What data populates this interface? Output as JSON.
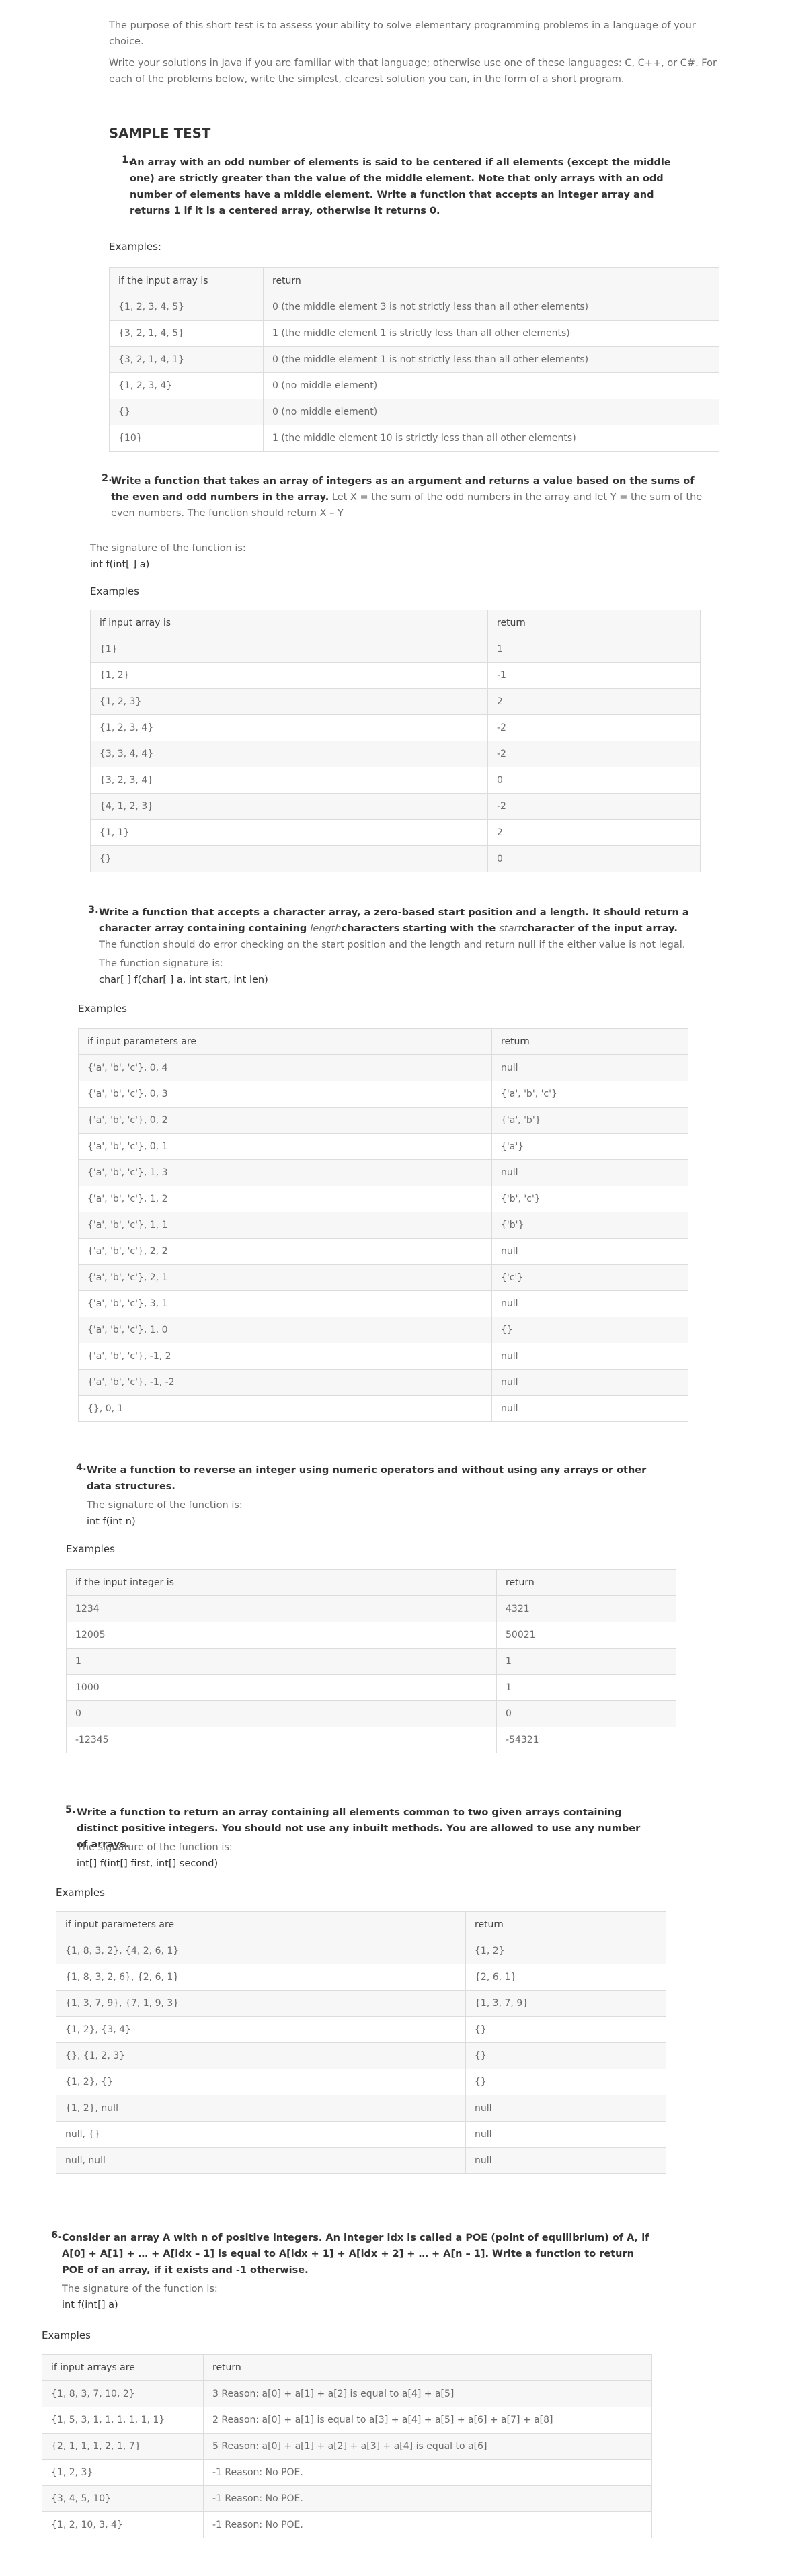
{
  "intro": {
    "p1": "The purpose of this short test is to assess your ability to solve elementary programming problems in a language of your choice.",
    "p2": "Write your solutions in Java if you are familiar with that language; otherwise use one of these languages: C, C++, or C#. For each of the problems below, write the simplest, clearest solution you can, in the form of a short program."
  },
  "sample_heading": "SAMPLE TEST",
  "questions": [
    {
      "num": "1.",
      "text_bold": "An array with an odd number of elements is said to be centered if all elements (except the middle one) are strictly greater than the value of the middle element. Note that only arrays with an odd number of elements have a middle element. Write a function that accepts an integer array and returns 1 if it is a centered array, otherwise it returns 0.",
      "examples_label": "Examples:",
      "headers": [
        "if the input array is",
        "return"
      ],
      "rows": [
        [
          "{1, 2, 3, 4, 5}",
          "0 (the middle element 3 is not strictly less than all other elements)"
        ],
        [
          "{3, 2, 1, 4, 5}",
          "1 (the middle element 1 is strictly less than all other elements)"
        ],
        [
          "{3, 2, 1, 4, 1}",
          "0 (the middle element 1 is not strictly less than all other elements)"
        ],
        [
          "{1, 2, 3, 4}",
          "0 (no middle element)"
        ],
        [
          "{}",
          "0 (no middle element)"
        ],
        [
          "{10}",
          "1 (the middle element 10 is strictly less than all other elements)"
        ]
      ]
    },
    {
      "num": "2.",
      "text_bold": "Write a function that takes an array of integers as an argument and returns a value based on the sums of the even and odd numbers in the array.",
      "text_normal": " Let X = the sum of the odd numbers in the array and let Y = the sum of the even numbers. The function should return X – Y",
      "sig_label": "The signature of the function is:",
      "sig_code": "int f(int[ ] a)",
      "examples_label": "Examples",
      "headers": [
        "if input array is",
        "return"
      ],
      "rows": [
        [
          "{1}",
          "1"
        ],
        [
          "{1, 2}",
          "-1"
        ],
        [
          "{1, 2, 3}",
          "2"
        ],
        [
          "{1, 2, 3, 4}",
          "-2"
        ],
        [
          "{3, 3, 4, 4}",
          "-2"
        ],
        [
          "{3, 2, 3, 4}",
          "0"
        ],
        [
          "{4, 1, 2, 3}",
          "-2"
        ],
        [
          "{1, 1}",
          "2"
        ],
        [
          "{}",
          "0"
        ]
      ]
    },
    {
      "num": "3.",
      "text_bold_a": "Write a function that accepts a character array, a zero-based start position and a length. It should return a character array containing containing ",
      "text_it_a": "length",
      "text_bold_b": "characters starting with the ",
      "text_it_b": "start",
      "text_bold_c": "character of the input array.",
      "text_normal": " The function should do error checking on the start position and the length and return null if the either value is not legal.",
      "sig_label": "The function signature is:",
      "sig_code": "char[ ] f(char[ ] a, int start, int len)",
      "examples_label": "Examples",
      "headers": [
        "if input parameters are",
        "return"
      ],
      "rows": [
        [
          "{'a', 'b', 'c'}, 0, 4",
          "null"
        ],
        [
          "{'a', 'b', 'c'}, 0, 3",
          "{'a', 'b', 'c'}"
        ],
        [
          "{'a', 'b', 'c'}, 0, 2",
          "{'a', 'b'}"
        ],
        [
          "{'a', 'b', 'c'}, 0, 1",
          "{'a'}"
        ],
        [
          "{'a', 'b', 'c'}, 1, 3",
          "null"
        ],
        [
          "{'a', 'b', 'c'}, 1, 2",
          "{'b', 'c'}"
        ],
        [
          "{'a', 'b', 'c'}, 1, 1",
          "{'b'}"
        ],
        [
          "{'a', 'b', 'c'}, 2, 2",
          "null"
        ],
        [
          "{'a', 'b', 'c'}, 2, 1",
          "{'c'}"
        ],
        [
          "{'a', 'b', 'c'}, 3, 1",
          "null"
        ],
        [
          "{'a', 'b', 'c'}, 1, 0",
          "{}"
        ],
        [
          "{'a', 'b', 'c'}, -1, 2",
          "null"
        ],
        [
          "{'a', 'b', 'c'}, -1, -2",
          "null"
        ],
        [
          "{}, 0, 1",
          "null"
        ]
      ]
    },
    {
      "num": "4.",
      "text_bold": "Write a function to reverse an integer using numeric operators and without using any arrays or other data structures.",
      "sig_label": "The signature of the function is:",
      "sig_code": "int f(int n)",
      "examples_label": "Examples",
      "headers": [
        "if the input integer is",
        "return"
      ],
      "rows": [
        [
          "1234",
          "4321"
        ],
        [
          "12005",
          "50021"
        ],
        [
          "1",
          "1"
        ],
        [
          "1000",
          "1"
        ],
        [
          "0",
          "0"
        ],
        [
          "-12345",
          "-54321"
        ]
      ]
    },
    {
      "num": "5.",
      "text_bold": "Write a function to return an array containing all elements common to two given arrays containing distinct positive integers. You should not use any inbuilt methods. You are allowed to use any number of arrays.",
      "sig_label": "The signature of the function is:",
      "sig_code": "int[] f(int[] first, int[] second)",
      "examples_label": "Examples",
      "headers": [
        "if input parameters are",
        "return"
      ],
      "rows": [
        [
          "{1, 8, 3, 2}, {4, 2, 6, 1}",
          "{1, 2}"
        ],
        [
          "{1, 8, 3, 2, 6}, {2, 6, 1}",
          "{2, 6, 1}"
        ],
        [
          "{1, 3, 7, 9}, {7, 1, 9, 3}",
          "{1, 3, 7, 9}"
        ],
        [
          "{1, 2}, {3, 4}",
          "{}"
        ],
        [
          "{}, {1, 2, 3}",
          "{}"
        ],
        [
          "{1, 2}, {}",
          "{}"
        ],
        [
          "{1, 2}, null",
          "null"
        ],
        [
          "null, {}",
          "null"
        ],
        [
          "null, null",
          "null"
        ]
      ]
    },
    {
      "num": "6.",
      "text_bold": "Consider an array A with n of positive integers. An integer idx is called a POE (point of equilibrium) of A, if A[0] + A[1] + … + A[idx – 1] is equal to A[idx + 1] + A[idx + 2] + … + A[n – 1]. Write a function to return POE of an array, if it exists and -1 otherwise.",
      "sig_label": "The signature of the function is:",
      "sig_code": "int f(int[] a)",
      "examples_label": "Examples",
      "headers": [
        "if input arrays are",
        "return"
      ],
      "rows": [
        [
          "{1, 8, 3, 7, 10, 2}",
          "3 Reason: a[0] + a[1] + a[2] is equal to a[4] + a[5]"
        ],
        [
          "{1, 5, 3, 1, 1, 1, 1, 1, 1}",
          "2 Reason: a[0] + a[1] is equal to a[3] + a[4] + a[5] + a[6] + a[7] + a[8]"
        ],
        [
          "{2, 1, 1, 1, 2, 1, 7}",
          "5 Reason: a[0] + a[1] + a[2] + a[3] + a[4] is equal to a[6]"
        ],
        [
          "{1, 2, 3}",
          "-1 Reason: No POE."
        ],
        [
          "{3, 4, 5, 10}",
          "-1 Reason: No POE."
        ],
        [
          "{1, 2, 10, 3, 4}",
          "-1 Reason: No POE."
        ]
      ]
    }
  ]
}
